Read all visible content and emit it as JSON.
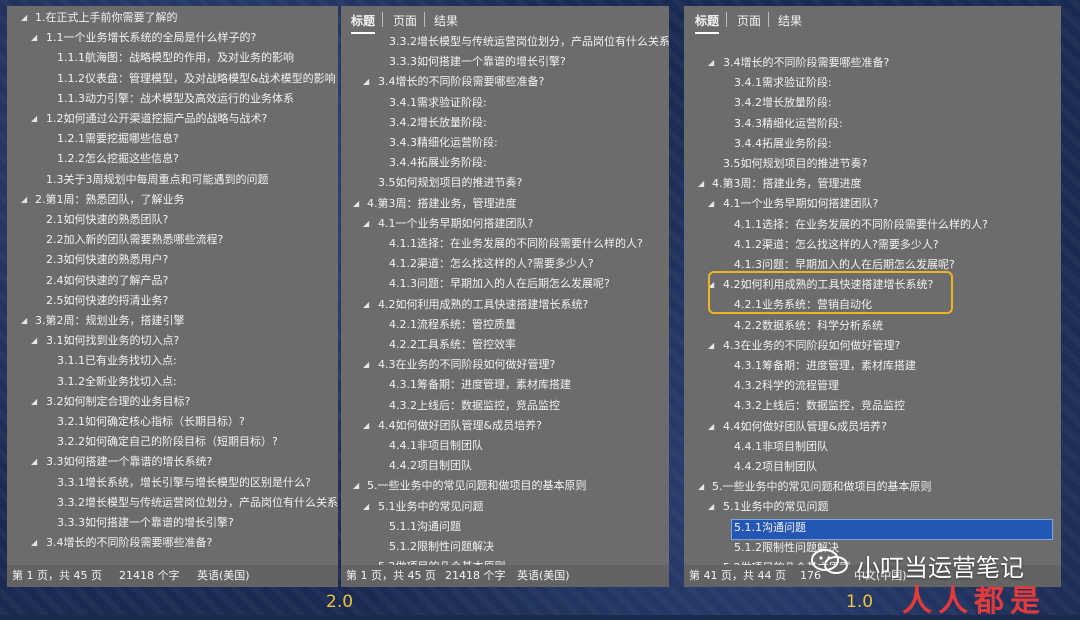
{
  "versions": {
    "left": "2.0",
    "right": "1.0"
  },
  "panels": {
    "p1": {
      "rows": [
        {
          "lvl": 1,
          "tri": "open",
          "t": "1.在正式上手前你需要了解的"
        },
        {
          "lvl": 2,
          "tri": "open",
          "t": "1.1一个业务增长系统的全局是什么样子的?"
        },
        {
          "lvl": 3,
          "tri": "",
          "t": "1.1.1航海图：战略模型的作用，及对业务的影响"
        },
        {
          "lvl": 3,
          "tri": "",
          "t": "1.1.2仪表盘：管理模型，及对战略模型&战术模型的影响"
        },
        {
          "lvl": 3,
          "tri": "",
          "t": "1.1.3动力引擎：战术模型及高效运行的业务体系"
        },
        {
          "lvl": 2,
          "tri": "open",
          "t": "1.2如何通过公开渠道挖掘产品的战略与战术?"
        },
        {
          "lvl": 3,
          "tri": "",
          "t": "1.2.1需要挖掘哪些信息?"
        },
        {
          "lvl": 3,
          "tri": "",
          "t": "1.2.2怎么挖掘这些信息?"
        },
        {
          "lvl": 2,
          "tri": "",
          "t": "1.3关于3周规划中每周重点和可能遇到的问题"
        },
        {
          "lvl": 1,
          "tri": "open",
          "t": "2.第1周：熟悉团队，了解业务"
        },
        {
          "lvl": 2,
          "tri": "",
          "t": "2.1如何快速的熟悉团队?"
        },
        {
          "lvl": 2,
          "tri": "",
          "t": "2.2加入新的团队需要熟悉哪些流程?"
        },
        {
          "lvl": 2,
          "tri": "",
          "t": "2.3如何快速的熟悉用户?"
        },
        {
          "lvl": 2,
          "tri": "",
          "t": "2.4如何快速的了解产品?"
        },
        {
          "lvl": 2,
          "tri": "",
          "t": "2.5如何快速的捋清业务?"
        },
        {
          "lvl": 1,
          "tri": "open",
          "t": "3.第2周：规划业务，搭建引擎"
        },
        {
          "lvl": 2,
          "tri": "open",
          "t": "3.1如何找到业务的切入点?"
        },
        {
          "lvl": 3,
          "tri": "",
          "t": "3.1.1已有业务找切入点:"
        },
        {
          "lvl": 3,
          "tri": "",
          "t": "3.1.2全新业务找切入点:"
        },
        {
          "lvl": 2,
          "tri": "open",
          "t": "3.2如何制定合理的业务目标?"
        },
        {
          "lvl": 3,
          "tri": "",
          "t": "3.2.1如何确定核心指标（长期目标）?"
        },
        {
          "lvl": 3,
          "tri": "",
          "t": "3.2.2如何确定自己的阶段目标（短期目标）?"
        },
        {
          "lvl": 2,
          "tri": "open",
          "t": "3.3如何搭建一个靠谱的增长系统?"
        },
        {
          "lvl": 3,
          "tri": "",
          "t": "3.3.1增长系统，增长引擎与增长模型的区别是什么?"
        },
        {
          "lvl": 3,
          "tri": "",
          "t": "3.3.2增长模型与传统运营岗位划分，产品岗位有什么关系?"
        },
        {
          "lvl": 3,
          "tri": "",
          "t": "3.3.3如何搭建一个靠谱的增长引擎?"
        },
        {
          "lvl": 2,
          "tri": "open",
          "t": "3.4增长的不同阶段需要哪些准备?"
        }
      ],
      "status": {
        "page": "第 1 页，共 45 页",
        "words": "21418 个字",
        "lang": "英语(美国)"
      }
    },
    "p2": {
      "tabs": [
        "标题",
        "页面",
        "结果"
      ],
      "rows": [
        {
          "lvl": 3,
          "tri": "",
          "t": "3.3.2增长模型与传统运营岗位划分，产品岗位有什么关系?"
        },
        {
          "lvl": 3,
          "tri": "",
          "t": "3.3.3如何搭建一个靠谱的增长引擎?"
        },
        {
          "lvl": 2,
          "tri": "open",
          "t": "3.4增长的不同阶段需要哪些准备?"
        },
        {
          "lvl": 3,
          "tri": "",
          "t": "3.4.1需求验证阶段:"
        },
        {
          "lvl": 3,
          "tri": "",
          "t": "3.4.2增长放量阶段:"
        },
        {
          "lvl": 3,
          "tri": "",
          "t": "3.4.3精细化运营阶段:"
        },
        {
          "lvl": 3,
          "tri": "",
          "t": "3.4.4拓展业务阶段:"
        },
        {
          "lvl": 2,
          "tri": "",
          "t": "3.5如何规划项目的推进节奏?"
        },
        {
          "lvl": 1,
          "tri": "open",
          "t": "4.第3周：搭建业务，管理进度"
        },
        {
          "lvl": 2,
          "tri": "open",
          "t": "4.1一个业务早期如何搭建团队?"
        },
        {
          "lvl": 3,
          "tri": "",
          "t": "4.1.1选择：在业务发展的不同阶段需要什么样的人?"
        },
        {
          "lvl": 3,
          "tri": "",
          "t": "4.1.2渠道：怎么找这样的人?需要多少人?"
        },
        {
          "lvl": 3,
          "tri": "",
          "t": "4.1.3问题：早期加入的人在后期怎么发展呢?"
        },
        {
          "lvl": 2,
          "tri": "open",
          "t": "4.2如何利用成熟的工具快速搭建增长系统?"
        },
        {
          "lvl": 3,
          "tri": "",
          "t": "4.2.1流程系统：管控质量"
        },
        {
          "lvl": 3,
          "tri": "",
          "t": "4.2.2工具系统：管控效率"
        },
        {
          "lvl": 2,
          "tri": "open",
          "t": "4.3在业务的不同阶段如何做好管理?"
        },
        {
          "lvl": 3,
          "tri": "",
          "t": "4.3.1筹备期：进度管理，素材库搭建"
        },
        {
          "lvl": 3,
          "tri": "",
          "t": "4.3.2上线后：数据监控，竞品监控"
        },
        {
          "lvl": 2,
          "tri": "open",
          "t": "4.4如何做好团队管理&成员培养?"
        },
        {
          "lvl": 3,
          "tri": "",
          "t": "4.4.1非项目制团队"
        },
        {
          "lvl": 3,
          "tri": "",
          "t": "4.4.2项目制团队"
        },
        {
          "lvl": 1,
          "tri": "open",
          "t": "5.一些业务中的常见问题和做项目的基本原则"
        },
        {
          "lvl": 2,
          "tri": "open",
          "t": "5.1业务中的常见问题"
        },
        {
          "lvl": 3,
          "tri": "",
          "t": "5.1.1沟通问题"
        },
        {
          "lvl": 3,
          "tri": "",
          "t": "5.1.2限制性问题解决"
        },
        {
          "lvl": 2,
          "tri": "",
          "t": "5.2做项目的几个基本原则"
        }
      ],
      "status": {
        "page": "第 1 页，共 45 页",
        "words": "21418 个字",
        "lang": "英语(美国)"
      }
    },
    "p3": {
      "tabs": [
        "标题",
        "页面",
        "结果"
      ],
      "rows": [
        {
          "lvl": 2,
          "tri": "open",
          "t": "3.4增长的不同阶段需要哪些准备?"
        },
        {
          "lvl": 3,
          "tri": "",
          "t": "3.4.1需求验证阶段:"
        },
        {
          "lvl": 3,
          "tri": "",
          "t": "3.4.2增长放量阶段:"
        },
        {
          "lvl": 3,
          "tri": "",
          "t": "3.4.3精细化运营阶段:"
        },
        {
          "lvl": 3,
          "tri": "",
          "t": "3.4.4拓展业务阶段:"
        },
        {
          "lvl": 2,
          "tri": "",
          "t": "3.5如何规划项目的推进节奏?"
        },
        {
          "lvl": 1,
          "tri": "open",
          "t": "4.第3周：搭建业务，管理进度"
        },
        {
          "lvl": 2,
          "tri": "open",
          "t": "4.1一个业务早期如何搭建团队?"
        },
        {
          "lvl": 3,
          "tri": "",
          "t": "4.1.1选择：在业务发展的不同阶段需要什么样的人?"
        },
        {
          "lvl": 3,
          "tri": "",
          "t": "4.1.2渠道：怎么找这样的人?需要多少人?"
        },
        {
          "lvl": 3,
          "tri": "",
          "t": "4.1.3问题：早期加入的人在后期怎么发展呢?"
        },
        {
          "lvl": 2,
          "tri": "open",
          "t": "4.2如何利用成熟的工具快速搭建增长系统?"
        },
        {
          "lvl": 3,
          "tri": "",
          "t": "4.2.1业务系统：营销自动化"
        },
        {
          "lvl": 3,
          "tri": "",
          "t": "4.2.2数据系统：科学分析系统"
        },
        {
          "lvl": 2,
          "tri": "open",
          "t": "4.3在业务的不同阶段如何做好管理?"
        },
        {
          "lvl": 3,
          "tri": "",
          "t": "4.3.1筹备期：进度管理，素材库搭建"
        },
        {
          "lvl": 3,
          "tri": "",
          "t": "4.3.2科学的流程管理"
        },
        {
          "lvl": 3,
          "tri": "",
          "t": "4.3.2上线后：数据监控，竞品监控"
        },
        {
          "lvl": 2,
          "tri": "open",
          "t": "4.4如何做好团队管理&成员培养?"
        },
        {
          "lvl": 3,
          "tri": "",
          "t": "4.4.1非项目制团队"
        },
        {
          "lvl": 3,
          "tri": "",
          "t": "4.4.2项目制团队"
        },
        {
          "lvl": 1,
          "tri": "open",
          "t": "5.一些业务中的常见问题和做项目的基本原则"
        },
        {
          "lvl": 2,
          "tri": "open",
          "t": "5.1业务中的常见问题"
        },
        {
          "lvl": 3,
          "tri": "",
          "t": "5.1.1沟通问题",
          "selected": true
        },
        {
          "lvl": 3,
          "tri": "",
          "t": "5.1.2限制性问题解决"
        },
        {
          "lvl": 2,
          "tri": "",
          "t": "5.2做项目的几个基本原则"
        }
      ],
      "status": {
        "page": "第 41 页，共 44 页",
        "words": "176",
        "lang": "中文(中国)"
      }
    }
  },
  "watermark": {
    "text": "小叮当运营笔记",
    "logo": "人人都是"
  }
}
